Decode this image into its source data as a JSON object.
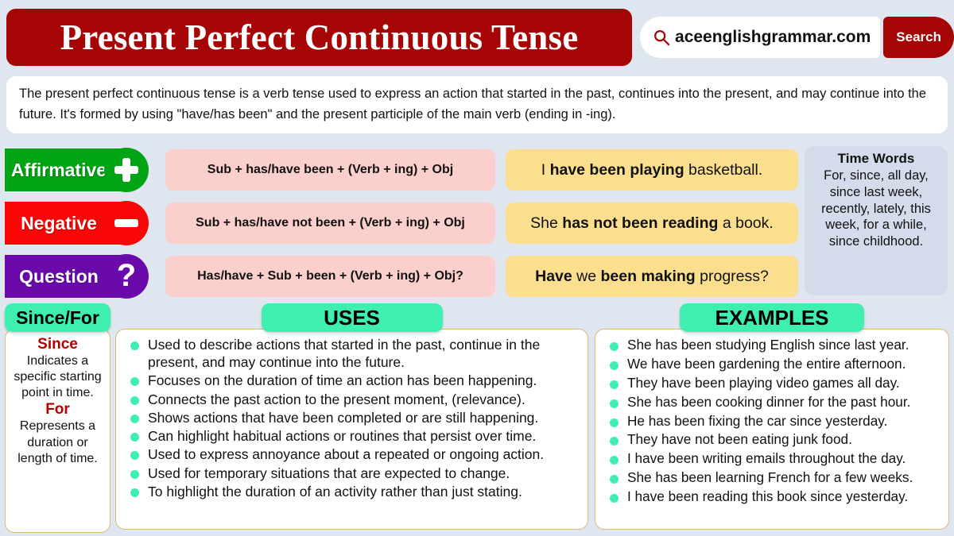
{
  "header": {
    "title": "Present Perfect Continuous Tense",
    "search_icon": "search-icon",
    "search_value": "aceenglishgrammar.com",
    "search_placeholder": "aceenglishgrammar.com",
    "search_button": "Search",
    "brand_color": "#a50505"
  },
  "intro": {
    "text": "The present perfect continuous tense is a verb tense used to express an action that started in the past, continues into the present, and may continue into the future. It's formed by using \"have/has been\" and the present participle of the main verb (ending in -ing)."
  },
  "forms": [
    {
      "label": "Affirmative",
      "symbol": "plus-icon",
      "color": "#00a414",
      "formula": "Sub + has/have been + (Verb + ing) + Obj",
      "example_plain_1": "I ",
      "example_bold": "have been playing",
      "example_plain_2": " basketball."
    },
    {
      "label": "Negative",
      "symbol": "minus-icon",
      "color": "#fb0606",
      "formula": "Sub + has/have not been + (Verb + ing) + Obj",
      "example_plain_1": "She ",
      "example_bold": "has not been reading",
      "example_plain_2": " a book."
    },
    {
      "label": "Question",
      "symbol": "question-mark-icon",
      "color": "#6b0aab",
      "formula": "Has/have + Sub + been + (Verb + ing) + Obj?",
      "example_plain_1": "",
      "example_bold": "Have",
      "example_plain_2": " we ",
      "example_bold_2": "been making",
      "example_plain_3": " progress?"
    }
  ],
  "time_words": {
    "title": "Time Words",
    "body": "For, since, all day, since last week, recently, lately, this week, for a while, since childhood.",
    "background": "#d4dcec"
  },
  "since_for": {
    "pill": "Since/For",
    "since_head": "Since",
    "since_body": "Indicates a specific starting point in time.",
    "for_head": "For",
    "for_body": "Represents a duration or length of time."
  },
  "uses": {
    "pill": "USES",
    "items": [
      "Used to describe actions that started in the past, continue in the present, and may continue into the future.",
      "Focuses on the duration of time an action has been happening.",
      "Connects the past action to the present moment, (relevance).",
      "Shows actions that have been completed or are still happening.",
      "Can highlight habitual actions or routines that persist over time.",
      "Used to express annoyance about a repeated or ongoing action.",
      "Used for temporary situations that are expected to change.",
      "To highlight the duration of an activity rather than just stating."
    ]
  },
  "examples": {
    "pill": "EXAMPLES",
    "items": [
      "She has been studying English since last year.",
      "We have been gardening the entire afternoon.",
      "They have been playing video games all day.",
      "She has been cooking dinner for the past hour.",
      "He has been fixing the car since yesterday.",
      "They have not been eating junk food.",
      "I have been writing emails throughout the day.",
      "She has been learning French for a few weeks.",
      "I have been reading this book since yesterday."
    ]
  },
  "theme": {
    "background": "#dfe6f0",
    "accent_mint": "#3eefb0",
    "formula_pink": "#fbcfcb",
    "example_yellow": "#fcdf8e",
    "panel_border": "#dcb975"
  }
}
